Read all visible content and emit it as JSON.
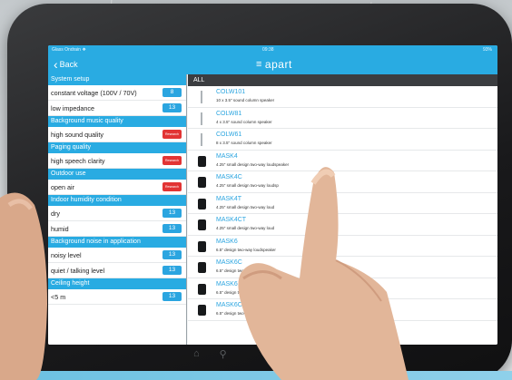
{
  "status": {
    "carrier": "Glass Ondrain ❖",
    "time": "09:38",
    "battery": "93%"
  },
  "nav": {
    "back_label": "Back",
    "logo_text": "apart",
    "logo_icon": "hamburger-menu-icon"
  },
  "left_panel": [
    {
      "header": "System setup",
      "options": [
        {
          "label": "constant voltage (100V / 70V)",
          "badge": "8",
          "badge_color": "#2ba5e0"
        },
        {
          "label": "low impedance",
          "badge": "13",
          "badge_color": "#2ba5e0"
        }
      ]
    },
    {
      "header": "Background music quality",
      "options": [
        {
          "label": "high sound quality",
          "badge": "Research",
          "badge_color": "#e23434"
        }
      ]
    },
    {
      "header": "Paging quality",
      "options": [
        {
          "label": "high speech clarity",
          "badge": "Research",
          "badge_color": "#e23434"
        }
      ]
    },
    {
      "header": "Outdoor use",
      "options": [
        {
          "label": "open air",
          "badge": "Research",
          "badge_color": "#e23434"
        }
      ]
    },
    {
      "header": "Indoor humidity condition",
      "options": [
        {
          "label": "dry",
          "badge": "13",
          "badge_color": "#2ba5e0"
        },
        {
          "label": "humid",
          "badge": "13",
          "badge_color": "#2ba5e0"
        }
      ]
    },
    {
      "header": "Background noise in application",
      "options": [
        {
          "label": "noisy level",
          "badge": "13",
          "badge_color": "#2ba5e0"
        },
        {
          "label": "quiet / talking level",
          "badge": "13",
          "badge_color": "#2ba5e0"
        }
      ]
    },
    {
      "header": "Ceiling height",
      "options": [
        {
          "label": "<5 m",
          "badge": "13",
          "badge_color": "#2ba5e0"
        }
      ]
    }
  ],
  "right_panel": {
    "header": "ALL",
    "products": [
      {
        "name": "COLW101",
        "desc": "10 x 3.5\" sound column speaker",
        "thumb": "column"
      },
      {
        "name": "COLW81",
        "desc": "4 x 3.5\" sound column speaker",
        "thumb": "column"
      },
      {
        "name": "COLW61",
        "desc": "8 x 3.5\" sound column speaker",
        "thumb": "column"
      },
      {
        "name": "MASK4",
        "desc": "4.25\" small design two-way loudspeaker",
        "thumb": "cube"
      },
      {
        "name": "MASK4C",
        "desc": "4.25\" small design two-way loudsp",
        "thumb": "cube"
      },
      {
        "name": "MASK4T",
        "desc": "4.25\" small design two-way loud",
        "thumb": "cube"
      },
      {
        "name": "MASK4CT",
        "desc": "4.25\" small design two-way loud",
        "thumb": "cube"
      },
      {
        "name": "MASK6",
        "desc": "6.5\" design two-way loudspeaker",
        "thumb": "cube"
      },
      {
        "name": "MASK6C",
        "desc": "6.5\" design two-way loud",
        "thumb": "cube"
      },
      {
        "name": "MASK6",
        "desc": "6.5\" design two-way",
        "thumb": "cube"
      },
      {
        "name": "MASK6C",
        "desc": "6.5\" design two-",
        "thumb": "cube"
      }
    ]
  },
  "home_bar": {
    "icons": [
      "home-icon",
      "search-icon"
    ]
  },
  "colors": {
    "accent": "#29abe2",
    "dark_header": "#3b3d40",
    "alert": "#e23434"
  }
}
